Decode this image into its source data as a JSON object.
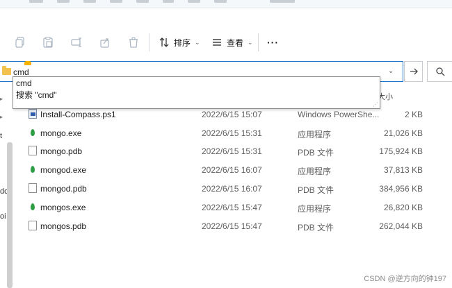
{
  "command_bar": {
    "sort_label": "排序",
    "view_label": "查看",
    "more_label": "···"
  },
  "address": {
    "path": "cmd"
  },
  "autocomplete": {
    "suggestion": "cmd",
    "search_option": "搜索 \"cmd\""
  },
  "columns": {
    "size_header_partial": "大小"
  },
  "nav_fragments": [
    "t",
    "do",
    "oi"
  ],
  "files": [
    {
      "name": "Install-Compass.ps1",
      "date": "2022/6/15 15:07",
      "type": "Windows PowerShe...",
      "size": "2 KB",
      "icon": "powershell-script-icon"
    },
    {
      "name": "mongo.exe",
      "date": "2022/6/15 15:31",
      "type": "应用程序",
      "size": "21,026 KB",
      "icon": "mongodb-leaf-icon"
    },
    {
      "name": "mongo.pdb",
      "date": "2022/6/15 15:31",
      "type": "PDB 文件",
      "size": "175,924 KB",
      "icon": "file-icon"
    },
    {
      "name": "mongod.exe",
      "date": "2022/6/15 16:07",
      "type": "应用程序",
      "size": "37,813 KB",
      "icon": "mongodb-leaf-icon"
    },
    {
      "name": "mongod.pdb",
      "date": "2022/6/15 16:07",
      "type": "PDB 文件",
      "size": "384,956 KB",
      "icon": "file-icon"
    },
    {
      "name": "mongos.exe",
      "date": "2022/6/15 15:47",
      "type": "应用程序",
      "size": "26,820 KB",
      "icon": "mongodb-leaf-icon"
    },
    {
      "name": "mongos.pdb",
      "date": "2022/6/15 15:47",
      "type": "PDB 文件",
      "size": "262,044 KB",
      "icon": "file-icon"
    }
  ],
  "watermark": "CSDN @逆方向的钟197",
  "colors": {
    "accent": "#1a73c8",
    "marker": "#f4b400",
    "mongo_leaf": "#2e9e44"
  }
}
